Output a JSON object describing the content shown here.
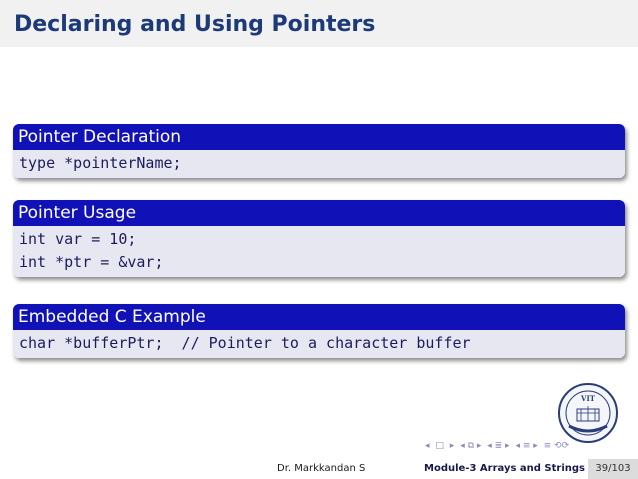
{
  "slide": {
    "title": "Declaring and Using Pointers"
  },
  "blocks": [
    {
      "heading": "Pointer Declaration",
      "lines": [
        "type *pointerName;"
      ]
    },
    {
      "heading": "Pointer Usage",
      "lines": [
        "int var = 10;",
        "int *ptr = &var;"
      ]
    },
    {
      "heading": "Embedded C Example",
      "lines": [
        "char *bufferPtr;  // Pointer to a character buffer"
      ]
    }
  ],
  "logo": {
    "text": "VIT"
  },
  "footer": {
    "author": "Dr. Markkandan S",
    "module": "Module-3  Arrays and Strings",
    "page": "39/103"
  },
  "colors": {
    "title": "#1d3a78",
    "block_header": "#1111b8",
    "block_body": "#e7e7f2"
  },
  "nav_icons": [
    "nav-left-icon",
    "nav-frame-icon",
    "nav-right-icon",
    "nav-subsection-icon",
    "nav-section-icon",
    "nav-align-icon",
    "nav-search-icon"
  ]
}
